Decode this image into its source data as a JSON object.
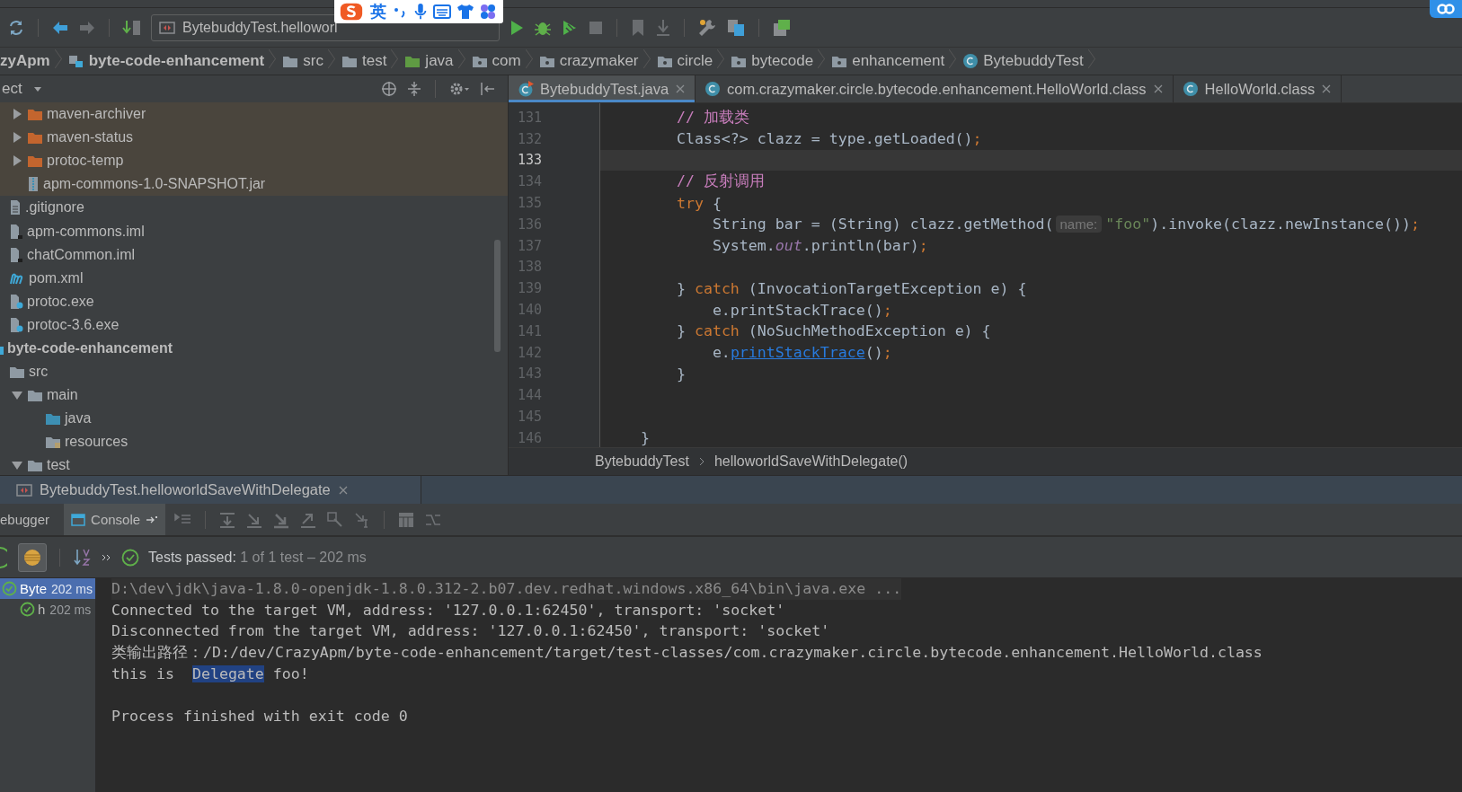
{
  "ime_bar": {
    "mode": "英"
  },
  "toolbar": {
    "run_configuration": "BytebuddyTest.helloworl"
  },
  "nav_bar": [
    {
      "kind": "project",
      "label": "zyApm"
    },
    {
      "kind": "module",
      "label": "byte-code-enhancement"
    },
    {
      "kind": "folder",
      "label": "src"
    },
    {
      "kind": "folder",
      "label": "test"
    },
    {
      "kind": "test-folder",
      "label": "java"
    },
    {
      "kind": "package",
      "label": "com"
    },
    {
      "kind": "package",
      "label": "crazymaker"
    },
    {
      "kind": "package",
      "label": "circle"
    },
    {
      "kind": "package",
      "label": "bytecode"
    },
    {
      "kind": "package",
      "label": "enhancement"
    },
    {
      "kind": "class",
      "label": "BytebuddyTest"
    }
  ],
  "project_panel": {
    "title": "ect",
    "tree": [
      {
        "kind": "continued",
        "children": [
          {
            "kind": "continued",
            "children": [
              {
                "kind": "folder-excluded",
                "label": "maven-archiver",
                "expanded": false,
                "excluded": true
              },
              {
                "kind": "folder-excluded",
                "label": "maven-status",
                "expanded": false,
                "excluded": true
              },
              {
                "kind": "folder-excluded",
                "label": "protoc-temp",
                "expanded": false,
                "excluded": true
              },
              {
                "kind": "jar",
                "label": "apm-commons-1.0-SNAPSHOT.jar",
                "excluded": true
              }
            ]
          },
          {
            "kind": "text-file",
            "label": ".gitignore"
          },
          {
            "kind": "iml",
            "label": "apm-commons.iml"
          },
          {
            "kind": "iml",
            "label": "chatCommon.iml"
          },
          {
            "kind": "maven",
            "label": "pom.xml"
          },
          {
            "kind": "unknown-file",
            "label": "protoc.exe"
          },
          {
            "kind": "unknown-file",
            "label": "protoc-3.6.exe"
          }
        ]
      },
      {
        "kind": "module",
        "label": "byte-code-enhancement",
        "children": [
          {
            "kind": "folder",
            "label": "src",
            "children": [
              {
                "kind": "folder",
                "label": "main",
                "expanded": true,
                "children": [
                  {
                    "kind": "folder-source",
                    "label": "java"
                  },
                  {
                    "kind": "folder-resources",
                    "label": "resources"
                  }
                ]
              },
              {
                "kind": "folder",
                "label": "test",
                "expanded": true
              }
            ]
          }
        ]
      }
    ]
  },
  "editor": {
    "tabs": [
      {
        "kind": "test-class",
        "label": "BytebuddyTest.java",
        "selected": true
      },
      {
        "kind": "class",
        "label": "com.crazymaker.circle.bytecode.enhancement.HelloWorld.class",
        "selected": false
      },
      {
        "kind": "class",
        "label": "HelloWorld.class",
        "selected": false
      }
    ],
    "lines": [
      {
        "number": "131",
        "current": false,
        "tokens": [
          {
            "kind": "comment",
            "text": "        // 加载类"
          }
        ]
      },
      {
        "number": "132",
        "current": false,
        "tokens": [
          {
            "kind": "plain",
            "text": "        Class<?> clazz = type.getLoaded()"
          },
          {
            "kind": "keyword",
            "text": ";"
          }
        ]
      },
      {
        "number": "133",
        "current": true
      },
      {
        "number": "134",
        "current": false,
        "tokens": [
          {
            "kind": "comment",
            "text": "        // 反射调用"
          }
        ]
      },
      {
        "number": "135",
        "current": false,
        "tokens": [
          {
            "kind": "keyword",
            "text": "        try"
          },
          {
            "kind": "plain",
            "text": " {"
          }
        ]
      },
      {
        "number": "136",
        "current": false,
        "tokens": [
          {
            "kind": "plain",
            "text": "            String bar = (String) clazz.getMethod("
          },
          {
            "kind": "hint",
            "text": "name:"
          },
          {
            "kind": "string",
            "text": "\"foo\""
          },
          {
            "kind": "plain",
            "text": ").invoke(clazz.newInstance())"
          },
          {
            "kind": "keyword",
            "text": ";"
          }
        ]
      },
      {
        "number": "137",
        "current": false,
        "tokens": [
          {
            "kind": "plain",
            "text": "            System."
          },
          {
            "kind": "field",
            "text": "out"
          },
          {
            "kind": "plain",
            "text": ".println(bar)"
          },
          {
            "kind": "keyword",
            "text": ";"
          }
        ]
      },
      {
        "number": "138",
        "current": false
      },
      {
        "number": "139",
        "current": false,
        "tokens": [
          {
            "kind": "plain",
            "text": "        } "
          },
          {
            "kind": "keyword",
            "text": "catch"
          },
          {
            "kind": "plain",
            "text": " (InvocationTargetException e) {"
          }
        ]
      },
      {
        "number": "140",
        "current": false,
        "tokens": [
          {
            "kind": "plain",
            "text": "            e.printStackTrace()"
          },
          {
            "kind": "keyword",
            "text": ";"
          }
        ]
      },
      {
        "number": "141",
        "current": false,
        "tokens": [
          {
            "kind": "plain",
            "text": "        } "
          },
          {
            "kind": "keyword",
            "text": "catch"
          },
          {
            "kind": "plain",
            "text": " (NoSuchMethodException e) {"
          }
        ]
      },
      {
        "number": "142",
        "current": false,
        "tokens": [
          {
            "kind": "plain",
            "text": "            e."
          },
          {
            "kind": "link",
            "text": "printStackTrace"
          },
          {
            "kind": "plain",
            "text": "()"
          },
          {
            "kind": "keyword",
            "text": ";"
          }
        ]
      },
      {
        "number": "143",
        "current": false,
        "tokens": [
          {
            "kind": "plain",
            "text": "        }"
          }
        ]
      },
      {
        "number": "144",
        "current": false
      },
      {
        "number": "145",
        "current": false
      },
      {
        "number": "146",
        "current": false,
        "tokens": [
          {
            "kind": "plain",
            "text": "    }"
          }
        ]
      }
    ],
    "breadcrumb": [
      "BytebuddyTest",
      "helloworldSaveWithDelegate()"
    ]
  },
  "run_panel": {
    "tabs": [
      {
        "label": "BytebuddyTest.helloworldSaveWithDelegate",
        "selected": true
      }
    ],
    "tool_tabs": [
      {
        "kind": "debugger",
        "label": "ebugger",
        "selected": false
      },
      {
        "kind": "console",
        "label": "Console",
        "selected": true
      }
    ],
    "status": {
      "label": "Tests passed:",
      "detail": "1 of 1 test – 202 ms"
    },
    "tests": [
      {
        "label": "Byte",
        "time": "202 ms",
        "selected": true,
        "children": [
          {
            "label": "h",
            "time": "202 ms",
            "selected": false
          }
        ]
      }
    ],
    "console": [
      {
        "kind": "command",
        "tokens": [
          {
            "kind": "plain",
            "text": "D:\\dev\\jdk\\java-1.8.0-openjdk-1.8.0.312-2.b07.dev.redhat.windows.x86_64\\bin\\java.exe ..."
          }
        ]
      },
      {
        "kind": "output",
        "tokens": [
          {
            "kind": "plain",
            "text": "Connected to the target VM, address: '127.0.0.1:62450', transport: 'socket'"
          }
        ]
      },
      {
        "kind": "output",
        "tokens": [
          {
            "kind": "plain",
            "text": "Disconnected from the target VM, address: '127.0.0.1:62450', transport: 'socket'"
          }
        ]
      },
      {
        "kind": "output",
        "tokens": [
          {
            "kind": "plain",
            "text": "类输出路径：/D:/dev/CrazyApm/byte-code-enhancement/target/test-classes/com.crazymaker.circle.bytecode.enhancement.HelloWorld.class"
          }
        ]
      },
      {
        "kind": "output",
        "tokens": [
          {
            "kind": "plain",
            "text": "this is  "
          },
          {
            "kind": "selected",
            "text": "Delegate"
          },
          {
            "kind": "plain",
            "text": " foo!"
          }
        ]
      },
      {
        "kind": "blank"
      },
      {
        "kind": "output",
        "tokens": [
          {
            "kind": "plain",
            "text": "Process finished with exit code 0"
          }
        ]
      }
    ]
  }
}
